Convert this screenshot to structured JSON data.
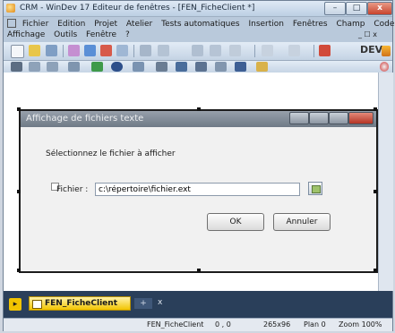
{
  "window": {
    "title": "CRM - WinDev 17  Editeur de fenêtres - [FEN_FicheClient *]",
    "controls": {
      "minimize": "–",
      "maximize": "□",
      "close": "x"
    }
  },
  "menu": {
    "row1": [
      "Fichier",
      "Edition",
      "Projet",
      "Atelier",
      "Tests automatiques",
      "Insertion",
      "Fenêtres",
      "Champ",
      "Code"
    ],
    "row2": [
      "Affichage",
      "Outils",
      "Fenêtre",
      "?"
    ],
    "mdi_controls": "_ ☐ x"
  },
  "brand": {
    "logo_text": "DEV"
  },
  "dialog": {
    "title": "Affichage de fichiers texte",
    "instruction": "Sélectionnez le fichier à afficher",
    "file_label": "Fichier :",
    "file_value": "c:\\répertoire\\fichier.ext",
    "ok_label": "OK",
    "cancel_label": "Annuler"
  },
  "taskbar": {
    "tab_label": "FEN_FicheClient",
    "new_tab": "+",
    "close_tab": "x"
  },
  "statusbar": {
    "window_name": "FEN_FicheClient",
    "coords": "0 , 0",
    "size": "265x96",
    "plan": "Plan 0",
    "zoom": "Zoom 100%"
  },
  "colors": {
    "accent": "#f2c400",
    "titlebar": "#bccfe3",
    "taskbar": "#2a3f5a"
  }
}
